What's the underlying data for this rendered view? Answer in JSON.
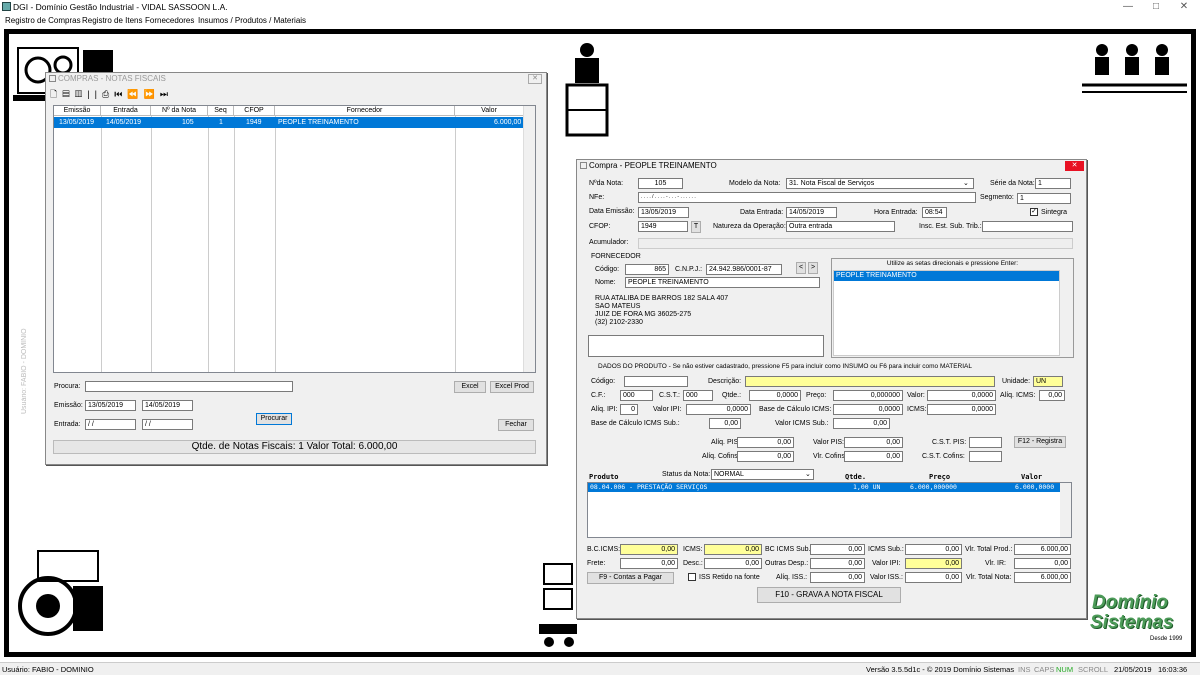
{
  "app": {
    "title": "DGI - Domínio Gestão Industrial - VIDAL SASSOON L.A."
  },
  "menu": [
    "Registro de Compras",
    "Registro de Itens",
    "Fornecedores",
    "Insumos / Produtos / Materiais"
  ],
  "side_text": "Usuário: FABIO - DOMINIO",
  "logo": {
    "line1": "Domínio",
    "line2": "Sistemas",
    "since": "Desde 1999"
  },
  "status": {
    "user": "Usuário: FABIO - DOMINIO",
    "version": "Versão 3.5.5d1c - © 2019 Domínio Sistemas",
    "ins": "INS",
    "caps": "CAPS",
    "num": "NUM",
    "scroll": "SCROLL",
    "date": "21/05/2019",
    "time": "16:03:36"
  },
  "list_win": {
    "title": "COMPRAS - NOTAS FISCAIS",
    "columns": [
      "Emissão",
      "Entrada",
      "Nº da Nota",
      "Seq",
      "CFOP",
      "Fornecedor",
      "Valor"
    ],
    "row": {
      "emissao": "13/05/2019",
      "entrada": "14/05/2019",
      "nota": "105",
      "seq": "1",
      "cfop": "1949",
      "fornecedor": "PEOPLE TREINAMENTO",
      "valor": "6.000,00"
    },
    "procura_label": "Procura:",
    "emissao_label": "Emissão:",
    "entrada_label": "Entrada:",
    "emissao_from": "13/05/2019",
    "emissao_to": "14/05/2019",
    "entrada_from": " / /",
    "entrada_to": " / /",
    "excel": "Excel",
    "excel_prod": "Excel Prod",
    "procurar": "Procurar",
    "fechar": "Fechar",
    "summary": "Qtde. de Notas Fiscais: 1     Valor Total: 6.000,00"
  },
  "compra": {
    "title": "Compra - PEOPLE TREINAMENTO",
    "nota_label": "Nºda Nota:",
    "nota": "105",
    "modelo_label": "Modelo da Nota:",
    "modelo": "31. Nota Fiscal de Serviços",
    "serie_label": "Série da Nota:",
    "serie": "1",
    "nfe_label": "NFe:",
    "nfe": ". . . . / . . . . - . . . - . . . . . .",
    "segmento_label": "Segmento:",
    "segmento": "1",
    "emissao_label": "Data Emissão:",
    "emissao": "13/05/2019",
    "entrada_label": "Data Entrada:",
    "entrada": "14/05/2019",
    "hora_label": "Hora Entrada:",
    "hora": "08:54",
    "sintegra": "Sintegra",
    "cfop_label": "CFOP:",
    "cfop": "1949",
    "t": "T",
    "natureza_label": "Natureza da Operação:",
    "natureza": "Outra entrada",
    "insc_label": "Insc. Est. Sub. Trib.:",
    "acumulador_label": "Acumulador:",
    "fornecedor_label": "FORNECEDOR",
    "codigo_label": "Código:",
    "codigo": "865",
    "cnpj_label": "C.N.P.J.:",
    "cnpj": "24.942.986/0001-87",
    "nome_label": "Nome:",
    "nome": "PEOPLE TREINAMENTO",
    "address": [
      "RUA ATALIBA DE BARROS 182 SALA 407",
      "SAO MATEUS",
      "JUIZ DE FORA  MG  36025-275",
      "(32) 2102-2330"
    ],
    "hint": "Utilize as setas direcionais e pressione Enter:",
    "hint_item": "PEOPLE TREINAMENTO",
    "produto_header": "DADOS DO PRODUTO - Se não estiver cadastrado, pressione F5 para incluir como INSUMO ou F6 para incluir como MATERIAL",
    "p_codigo": "Código:",
    "p_desc": "Descrição:",
    "p_unidade": "Unidade:",
    "unidade": "UN",
    "cf": "C.F.:",
    "cf_val": "000",
    "cst": "C.S.T.:",
    "cst_val": "000",
    "qtde": "Qtde.:",
    "qtde_val": "0,0000",
    "preco": "Preço:",
    "preco_val": "0,000000",
    "valor": "Valor:",
    "valor_val": "0,0000",
    "aliq_icms": "Alíq. ICMS:",
    "aliq_icms_val": "0,00",
    "aliq_ipi": "Alíq. IPI:",
    "aliq_ipi_val": "0",
    "valor_ipi": "Valor IPI:",
    "valor_ipi_val": "0,0000",
    "base_icms": "Base de Cálculo ICMS:",
    "base_icms_val": "0,0000",
    "icms": "ICMS:",
    "icms_val": "0,0000",
    "base_icms_sub": "Base de Cálculo ICMS Sub.:",
    "base_icms_sub_val": "0,00",
    "valor_icms_sub": "Valor ICMS Sub.:",
    "valor_icms_sub_val": "0,00",
    "aliq_pis": "Alíq. PIS:",
    "aliq_pis_val": "0,00",
    "valor_pis": "Valor PIS:",
    "valor_pis_val": "0,00",
    "cst_pis": "C.S.T. PIS:",
    "f12": "F12 - Registra",
    "aliq_cofins": "Alíq. Cofins:",
    "aliq_cofins_val": "0,00",
    "vlr_cofins": "Vlr. Cofins:",
    "vlr_cofins_val": "0,00",
    "cst_cofins": "C.S.T. Cofins:",
    "col_produto": "Produto",
    "status_label": "Status da Nota:",
    "status": "NORMAL",
    "col_qtde": "Qtde.",
    "col_preco": "Preço",
    "col_valor": "Valor",
    "item": {
      "produto": "08.04.006 - PRESTAÇÃO SERVIÇOS",
      "qtde": "1,00 UN",
      "preco": "6.000,000000",
      "valor": "6.000,0000"
    },
    "totals": {
      "bc_icms": "B.C.ICMS:",
      "bc_icms_v": "0,00",
      "icms": "ICMS:",
      "icms_v": "0,00",
      "bc_icms_sub": "BC ICMS Sub.:",
      "bc_icms_sub_v": "0,00",
      "icms_sub": "ICMS Sub.:",
      "icms_sub_v": "0,00",
      "vlr_total_prod": "Vlr. Total Prod.:",
      "vlr_total_prod_v": "6.000,00",
      "frete": "Frete:",
      "frete_v": "0,00",
      "desc": "Desc.:",
      "desc_v": "0,00",
      "outras": "Outras Desp.:",
      "outras_v": "0,00",
      "valor_ipi": "Valor IPI:",
      "valor_ipi_v": "0,00",
      "vlr_ir": "Vlr. IR:",
      "vlr_ir_v": "0,00",
      "aliq_iss": "Alíq. ISS.:",
      "aliq_iss_v": "0,00",
      "valor_iss": "Valor ISS.:",
      "valor_iss_v": "0,00",
      "vlr_total_nota": "Vlr. Total Nota:",
      "vlr_total_nota_v": "6.000,00"
    },
    "f9": "F9 - Contas a Pagar",
    "iss_retido": "ISS Retido na fonte",
    "f10": "F10 - GRAVA A NOTA FISCAL"
  }
}
